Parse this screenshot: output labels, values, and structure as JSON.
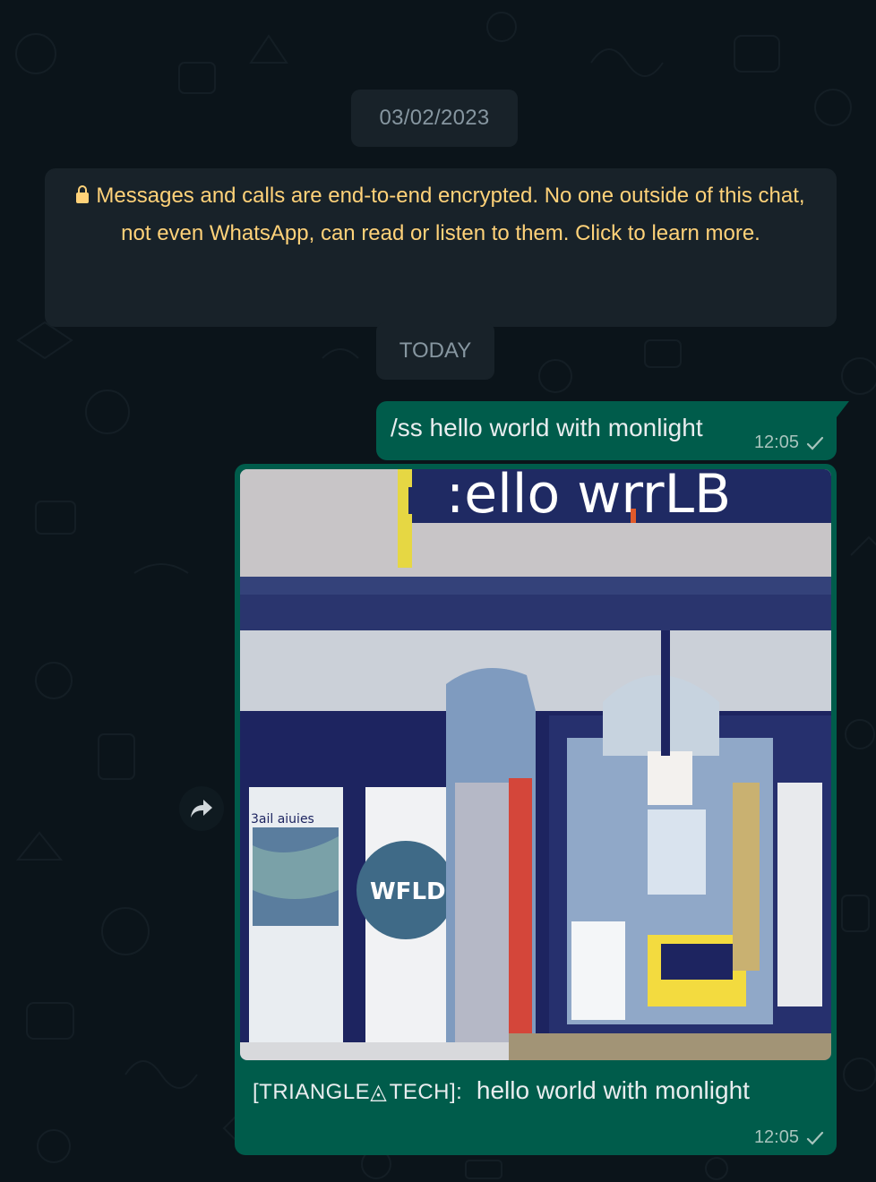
{
  "chat": {
    "date_divider": "03/02/2023",
    "encryption_notice": "Messages and calls are end-to-end encrypted. No one outside of this chat, not even WhatsApp, can read or listen to them. Click to learn more.",
    "today_divider": "TODAY"
  },
  "messages": [
    {
      "direction": "outgoing",
      "text": "/ss hello world with monlight",
      "time": "12:05",
      "status_icon": "single-check-icon"
    },
    {
      "direction": "outgoing",
      "type": "image",
      "image_text_visible": ":ello wrrLB",
      "image_labels": [
        "3ail aiuies",
        "WFLD"
      ],
      "sender_tag": "[TRIANGLE◬ TECH]:",
      "caption": "hello world with monlight",
      "time": "12:05",
      "status_icon": "single-check-icon"
    }
  ],
  "icons": {
    "lock": "lock-icon",
    "forward": "forward-icon",
    "check": "single-check-icon"
  },
  "colors": {
    "background": "#0b141a",
    "system_chip": "#182229",
    "notice_text": "#ffd279",
    "outgoing_bubble": "#005c4b"
  }
}
